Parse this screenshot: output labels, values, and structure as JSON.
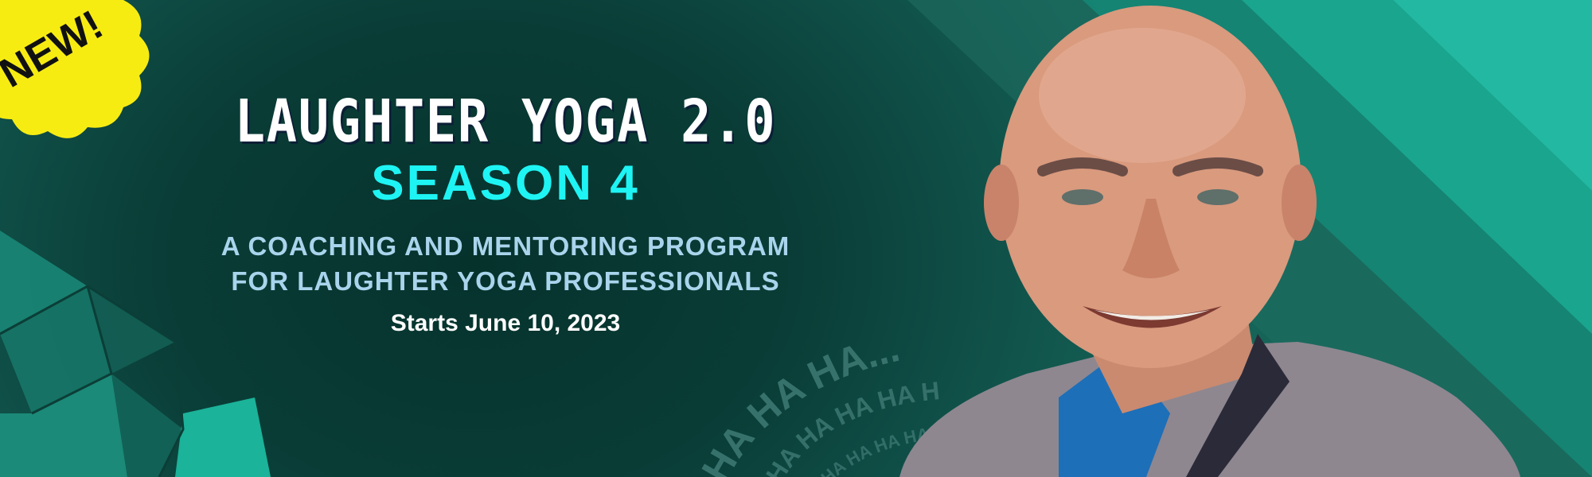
{
  "badge": {
    "label": "NEW!"
  },
  "headline": {
    "title": "LAUGHTER YOGA 2.0",
    "season": "SEASON 4",
    "subtitle_line1": "A COACHING AND MENTORING PROGRAM",
    "subtitle_line2": "FOR LAUGHTER YOGA PROFESSIONALS",
    "start_date": "Starts June 10, 2023"
  },
  "decor": {
    "laughter_text_outer": "HA HA HA...",
    "laughter_text_mid": "HA HA HA HA H",
    "laughter_text_inner": "HA HA HA HA"
  },
  "colors": {
    "background_dark": "#06322c",
    "accent_teal": "#1ab39a",
    "season_cyan": "#1ef4f4",
    "subtitle_blue": "#a9d4ec",
    "badge_yellow": "#f7ec12"
  }
}
